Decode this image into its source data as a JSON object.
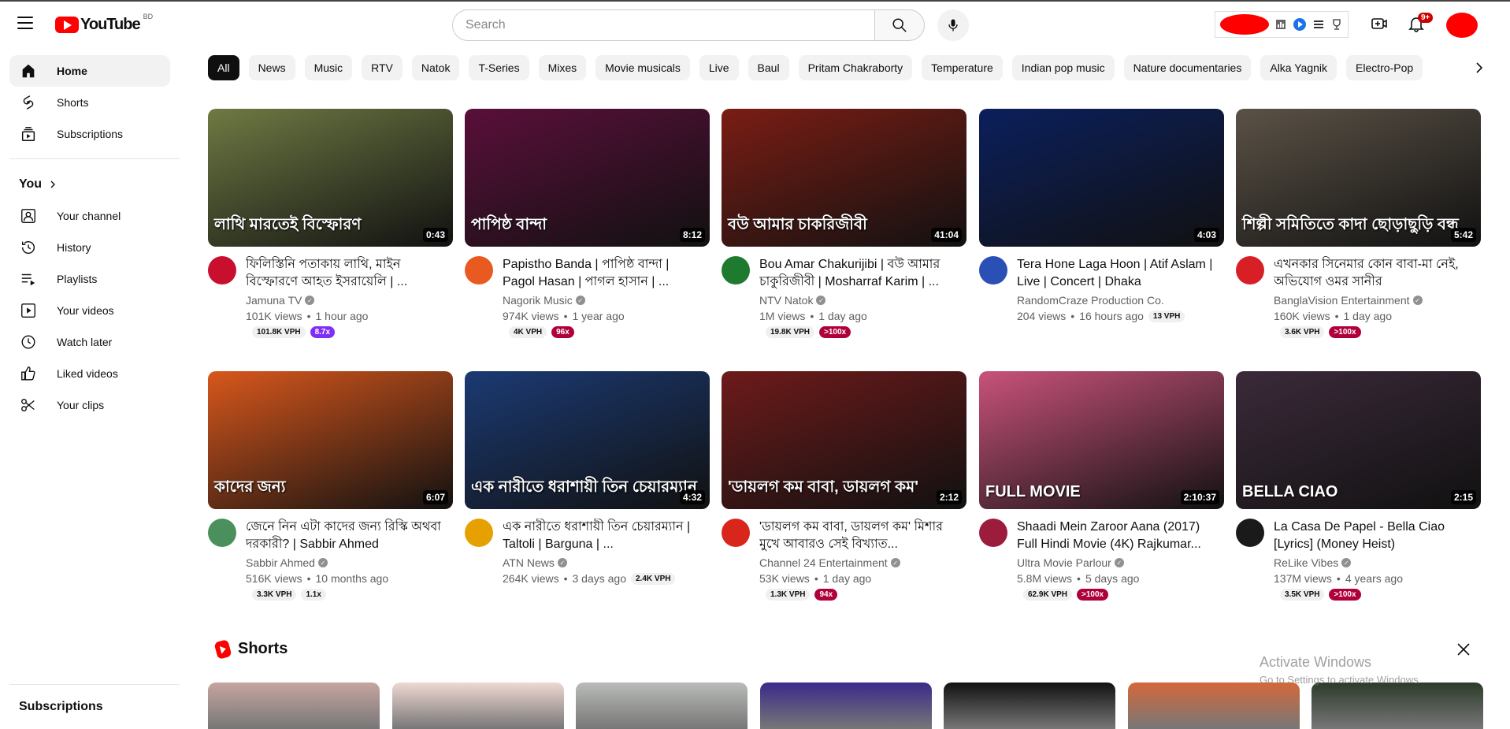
{
  "header": {
    "logo_text": "YouTube",
    "country_code": "BD",
    "search_placeholder": "Search",
    "notification_count": "9+"
  },
  "sidebar": {
    "main": [
      {
        "label": "Home",
        "icon": "home-icon"
      },
      {
        "label": "Shorts",
        "icon": "shorts-icon"
      },
      {
        "label": "Subscriptions",
        "icon": "subscriptions-icon"
      }
    ],
    "you_title": "You",
    "you_items": [
      {
        "label": "Your channel",
        "icon": "channel-icon"
      },
      {
        "label": "History",
        "icon": "history-icon"
      },
      {
        "label": "Playlists",
        "icon": "playlists-icon"
      },
      {
        "label": "Your videos",
        "icon": "your-videos-icon"
      },
      {
        "label": "Watch later",
        "icon": "watch-later-icon"
      },
      {
        "label": "Liked videos",
        "icon": "liked-icon"
      },
      {
        "label": "Your clips",
        "icon": "clips-icon"
      }
    ],
    "subscriptions_title": "Subscriptions"
  },
  "chips": [
    "All",
    "News",
    "Music",
    "RTV",
    "Natok",
    "T-Series",
    "Mixes",
    "Movie musicals",
    "Live",
    "Baul",
    "Pritam Chakraborty",
    "Temperature",
    "Indian pop music",
    "Nature documentaries",
    "Alka Yagnik",
    "Electro-Pop"
  ],
  "videos": [
    {
      "title": "ফিলিস্তিনি পতাকায় লাথি, মাইন বিস্ফোরণে আহত ইসরায়েলি | ...",
      "thumb_text": "লাথি মারতেই বিস্ফোরণ",
      "duration": "0:43",
      "channel": "Jamuna TV",
      "verified": true,
      "views": "101K views",
      "age": "1 hour ago",
      "vph": "101.8K VPH",
      "mult": "8.7x",
      "mult_style": "purple",
      "thumb_color": "#6e7a43",
      "avatar_color": "#c8102e"
    },
    {
      "title": "Papistho Banda | পাপিষ্ঠ বান্দা | Pagol Hasan | পাগল হাসান | ...",
      "thumb_text": "পাপিষ্ঠ বান্দা",
      "duration": "8:12",
      "channel": "Nagorik Music",
      "verified": true,
      "views": "974K views",
      "age": "1 year ago",
      "vph": "4K VPH",
      "mult": "96x",
      "mult_style": "crimson",
      "thumb_color": "#5a0f3a",
      "avatar_color": "#e85a1f"
    },
    {
      "title": "Bou Amar Chakurijibi | বউ আমার চাকুরিজীবী | Mosharraf Karim | ...",
      "thumb_text": "বউ আমার চাকরিজীবী",
      "duration": "41:04",
      "channel": "NTV Natok",
      "verified": true,
      "views": "1M views",
      "age": "1 day ago",
      "vph": "19.8K VPH",
      "mult": ">100x",
      "mult_style": "crimson",
      "thumb_color": "#7a1d14",
      "avatar_color": "#1d7a2e"
    },
    {
      "title": "Tera Hone Laga Hoon | Atif Aslam | Live | Concert | Dhaka",
      "thumb_text": "",
      "duration": "4:03",
      "channel": "RandomCraze Production Co.",
      "verified": false,
      "views": "204 views",
      "age": "16 hours ago",
      "vph": "13 VPH",
      "mult": "",
      "mult_style": "",
      "thumb_color": "#0b1f5c",
      "avatar_color": "#2a4fb5"
    },
    {
      "title": "এখনকার সিনেমার কোন বাবা-মা নেই, অভিযোগ ওমর সানীর",
      "thumb_text": "শিল্পী সমিতিতে কাদা ছোড়াছুড়ি বন্ধ",
      "duration": "5:42",
      "channel": "BanglaVision Entertainment",
      "verified": true,
      "views": "160K views",
      "age": "1 day ago",
      "vph": "3.6K VPH",
      "mult": ">100x",
      "mult_style": "crimson",
      "thumb_color": "#5b5246",
      "avatar_color": "#d81f26"
    },
    {
      "title": "জেনে নিন এটা কাদের জন্য রিস্কি অথবা দরকারী? | Sabbir Ahmed",
      "thumb_text": "কাদের জন্য",
      "duration": "6:07",
      "channel": "Sabbir Ahmed",
      "verified": true,
      "views": "516K views",
      "age": "10 months ago",
      "vph": "3.3K VPH",
      "mult": "1.1x",
      "mult_style": "",
      "thumb_color": "#d8571c",
      "avatar_color": "#4a8f5c"
    },
    {
      "title": "এক নারীতে ধরাশায়ী তিন চেয়ারম্যান | Taltoli | Barguna | ...",
      "thumb_text": "এক নারীতে ধরাশায়ী তিন চেয়ারম্যান",
      "duration": "4:32",
      "channel": "ATN News",
      "verified": true,
      "views": "264K views",
      "age": "3 days ago",
      "vph": "2.4K VPH",
      "mult": "",
      "mult_style": "",
      "thumb_color": "#1b3a73",
      "avatar_color": "#e6a000"
    },
    {
      "title": "'ডায়লগ কম বাবা, ডায়লগ কম' মিশার মুখে আবারও সেই বিখ্যাত...",
      "thumb_text": "'ডায়লগ কম বাবা, ডায়লগ কম'",
      "duration": "2:12",
      "channel": "Channel 24 Entertainment",
      "verified": true,
      "views": "53K views",
      "age": "1 day ago",
      "vph": "1.3K VPH",
      "mult": "94x",
      "mult_style": "crimson",
      "thumb_color": "#6e1a1a",
      "avatar_color": "#d9261c"
    },
    {
      "title": "Shaadi Mein Zaroor Aana (2017) Full Hindi Movie (4K) Rajkumar...",
      "thumb_text": "FULL MOVIE",
      "duration": "2:10:37",
      "channel": "Ultra Movie Parlour",
      "verified": true,
      "views": "5.8M views",
      "age": "5 days ago",
      "vph": "62.9K VPH",
      "mult": ">100x",
      "mult_style": "crimson",
      "thumb_color": "#c9527a",
      "avatar_color": "#9c1c3c"
    },
    {
      "title": "La Casa De Papel - Bella Ciao [Lyrics] (Money Heist)",
      "thumb_text": "BELLA CIAO",
      "duration": "2:15",
      "channel": "ReLike Vibes",
      "verified": true,
      "views": "137M views",
      "age": "4 years ago",
      "vph": "3.5K VPH",
      "mult": ">100x",
      "mult_style": "crimson",
      "thumb_color": "#3b2a3a",
      "avatar_color": "#1a1a1a"
    }
  ],
  "shorts": {
    "title": "Shorts",
    "thumbs": [
      "#c6a5a0",
      "#efd8d2",
      "#b9bcb8",
      "#3b2a8a",
      "#111111",
      "#d4683a",
      "#2c3b2a"
    ]
  },
  "watermark": {
    "line1": "Activate Windows",
    "line2": "Go to Settings to activate Windows."
  }
}
